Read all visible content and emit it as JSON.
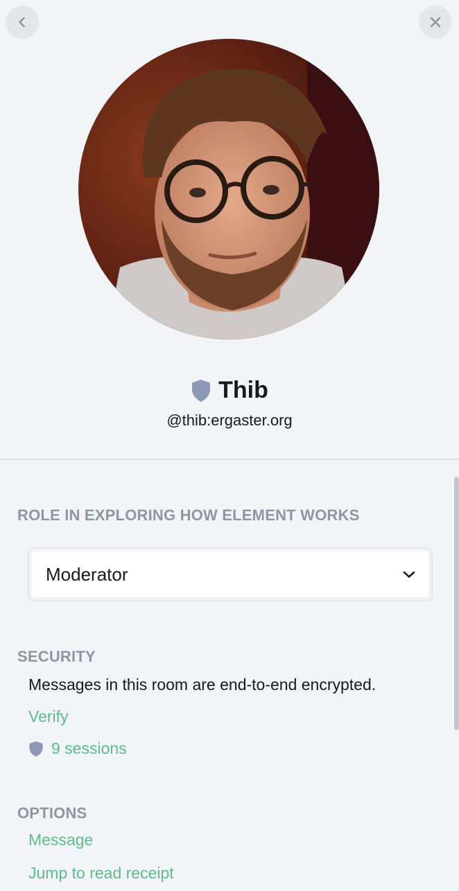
{
  "header": {
    "back_icon": "chevron-left-icon",
    "close_icon": "close-icon"
  },
  "profile": {
    "name": "Thib",
    "user_id": "@thib:ergaster.org",
    "verified_icon": "shield-icon"
  },
  "role": {
    "heading": "ROLE IN EXPLORING HOW ELEMENT WORKS",
    "selected": "Moderator",
    "dropdown_icon": "chevron-down-icon"
  },
  "security": {
    "heading": "SECURITY",
    "description": "Messages in this room are end-to-end encrypted.",
    "verify_label": "Verify",
    "sessions_label": "9 sessions"
  },
  "options": {
    "heading": "OPTIONS",
    "items": [
      "Message",
      "Jump to read receipt"
    ]
  },
  "colors": {
    "link": "#5cbb8f",
    "heading": "#8d96a5",
    "shield": "#8d99b5",
    "background": "#f2f4f8"
  }
}
